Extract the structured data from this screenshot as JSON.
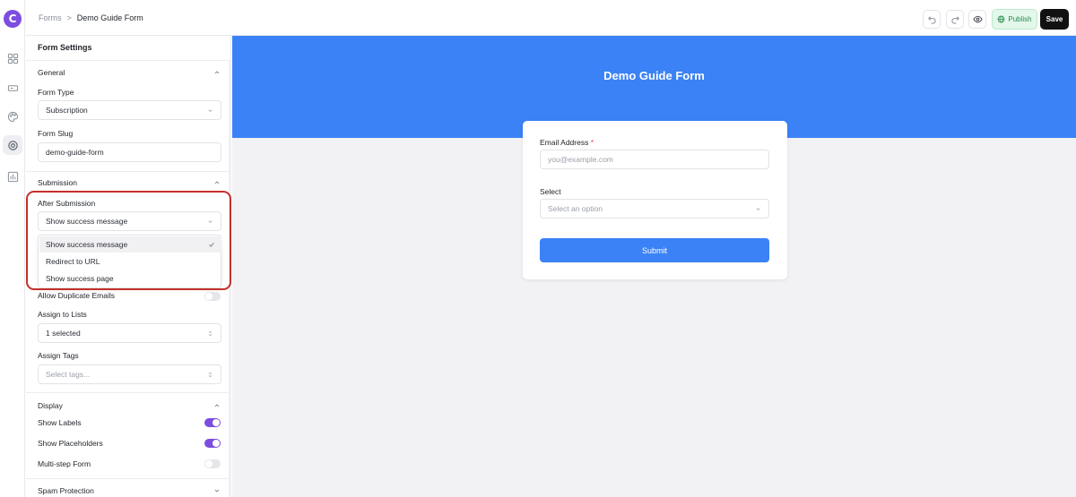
{
  "app": {
    "logo_letter": "C"
  },
  "breadcrumb": {
    "parent": "Forms",
    "separator": ">",
    "current": "Demo Guide Form"
  },
  "toolbar": {
    "publish_label": "Publish",
    "save_label": "Save"
  },
  "panel": {
    "title": "Form Settings",
    "general": {
      "title": "General",
      "form_type_label": "Form Type",
      "form_type_value": "Subscription",
      "form_slug_label": "Form Slug",
      "form_slug_value": "demo-guide-form"
    },
    "submission": {
      "title": "Submission",
      "after_submission_label": "After Submission",
      "after_submission_value": "Show success message",
      "options": [
        "Show success message",
        "Redirect to URL",
        "Show success page"
      ],
      "allow_duplicate_label": "Allow Duplicate Emails",
      "allow_duplicate_on": false,
      "assign_lists_label": "Assign to Lists",
      "assign_lists_value": "1 selected",
      "assign_tags_label": "Assign Tags",
      "assign_tags_placeholder": "Select tags..."
    },
    "display": {
      "title": "Display",
      "show_labels_label": "Show Labels",
      "show_labels_on": true,
      "show_placeholders_label": "Show Placeholders",
      "show_placeholders_on": true,
      "multistep_label": "Multi-step Form",
      "multistep_on": false
    },
    "spam": {
      "title": "Spam Protection"
    }
  },
  "preview": {
    "form_title": "Demo Guide Form",
    "email_label": "Email Address",
    "required_mark": "*",
    "email_placeholder": "you@example.com",
    "select_label": "Select",
    "select_placeholder": "Select an option",
    "submit_label": "Submit"
  },
  "colors": {
    "accent": "#7c4dde",
    "banner": "#3b82f6",
    "highlight": "#c4302b",
    "publish_bg": "#e3f7ea"
  }
}
